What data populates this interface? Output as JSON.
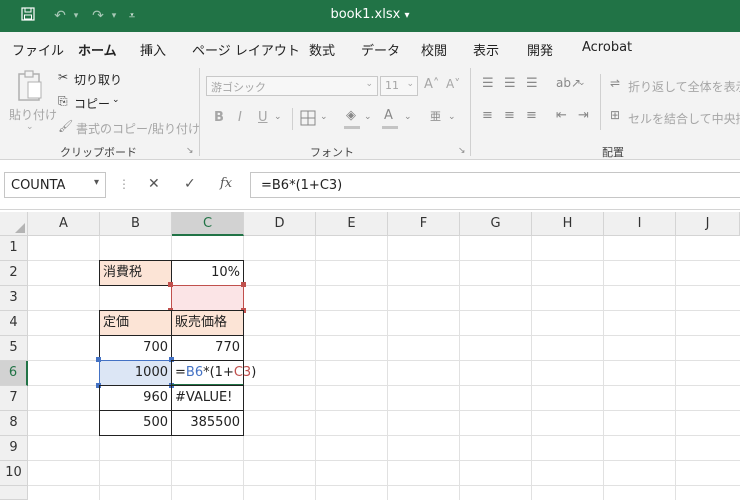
{
  "title_bar": {
    "file_name": "book1.xlsx",
    "title_arrow": "▾",
    "icons": [
      "save-icon",
      "undo-icon",
      "redo-icon",
      "customize-qat-icon"
    ]
  },
  "ribbon_tabs": [
    "ファイル",
    "ホーム",
    "挿入",
    "ページ レイアウト",
    "数式",
    "データ",
    "校閲",
    "表示",
    "開発",
    "Acrobat"
  ],
  "ribbon": {
    "clipboard": {
      "paste": "貼り付け",
      "cut": "切り取り",
      "copy": "コピー",
      "format_painter": "書式のコピー/貼り付け",
      "label": "クリップボード"
    },
    "font": {
      "font_name": "游ゴシック",
      "font_size": "11",
      "bold": "B",
      "italic": "I",
      "underline": "U",
      "grow": "A˄",
      "shrink": "A˅",
      "label": "フォント"
    },
    "alignment": {
      "wrap_text": "折り返して全体を表示す",
      "merge_center": "セルを結合して中央揃え",
      "label": "配置"
    }
  },
  "formula_bar": {
    "name_box": "COUNTA",
    "cancel": "✕",
    "enter": "✓",
    "fx": "fx",
    "formula": "=B6*(1+C3)"
  },
  "sheet": {
    "columns": [
      "A",
      "B",
      "C",
      "D",
      "E",
      "F",
      "G",
      "H",
      "I",
      "J"
    ],
    "rows": [
      "1",
      "2",
      "3",
      "4",
      "5",
      "6",
      "7",
      "8",
      "9",
      "10"
    ],
    "cells": {
      "B2": "消費税",
      "C2": "10%",
      "B4": "定価",
      "C4": "販売価格",
      "B5": "700",
      "C5": "770",
      "B6": "1000",
      "B7": "960",
      "C7": "#VALUE!",
      "B8": "500",
      "C8": "385500"
    },
    "edit_formula": {
      "eq": "=",
      "ref1": "B6",
      "mid": "*(1+",
      "ref2": "C3",
      "end": ")"
    },
    "active_cell": "C6",
    "colors": {
      "header_fill": "#fce4d6",
      "ref1_color": "#4472c4",
      "ref2_color": "#c0504d",
      "accent": "#217346"
    }
  }
}
